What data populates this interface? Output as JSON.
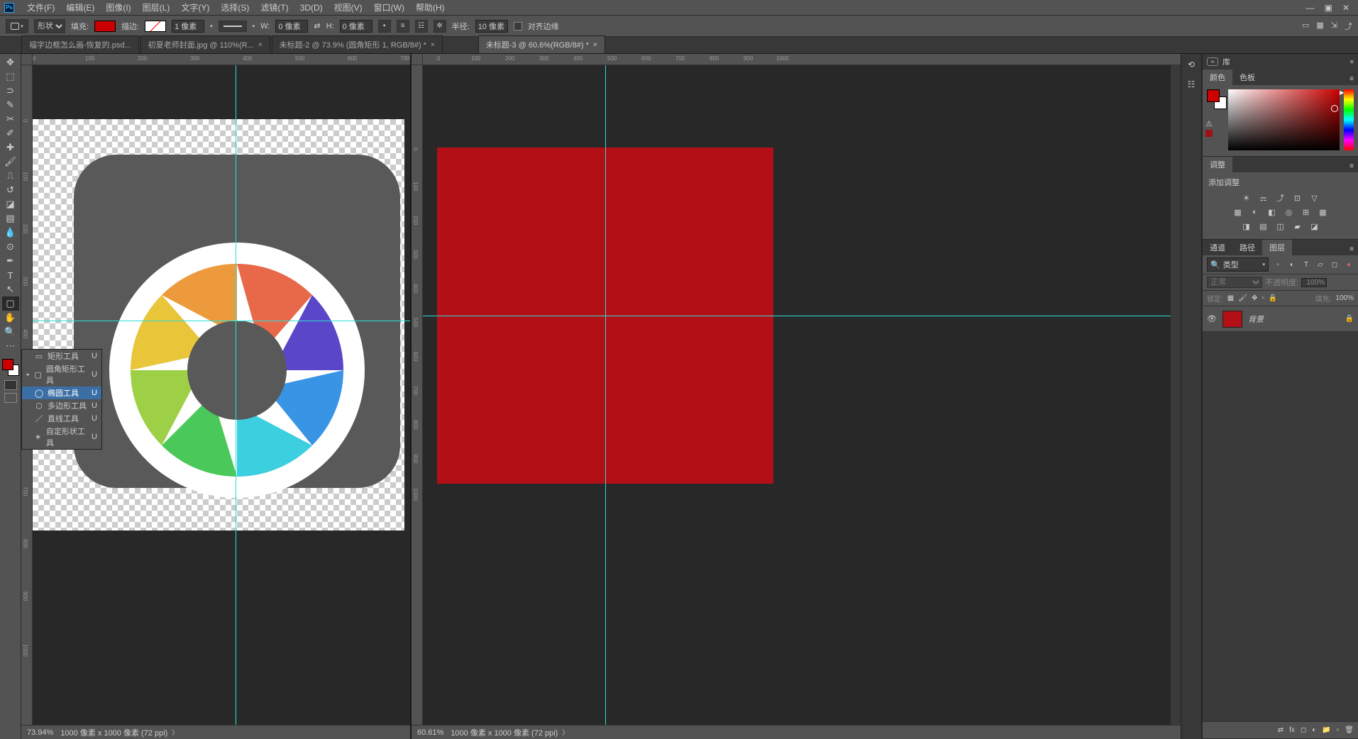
{
  "menubar": {
    "items": [
      "文件(F)",
      "编辑(E)",
      "图像(I)",
      "图层(L)",
      "文字(Y)",
      "选择(S)",
      "滤镜(T)",
      "3D(D)",
      "视图(V)",
      "窗口(W)",
      "帮助(H)"
    ]
  },
  "optionsbar": {
    "shape_mode": "形状",
    "fill_label": "填充:",
    "stroke_label": "描边:",
    "stroke_width": "1 像素",
    "w_label": "W:",
    "w_value": "0 像素",
    "h_label": "H:",
    "h_value": "0 像素",
    "radius_label": "半径:",
    "radius_value": "10 像素",
    "align_edges": "对齐边缘"
  },
  "doc_tabs": [
    {
      "title": "福字边框怎么画-恢复的.psd...",
      "active": false
    },
    {
      "title": "初夏老师封面.jpg @ 110%(R...",
      "active": false
    },
    {
      "title": "未标题-2 @ 73.9% (圆角矩形 1, RGB/8#) *",
      "active": false
    },
    {
      "title": "未标题-3 @ 60.6%(RGB/8#) *",
      "active": true
    }
  ],
  "tool_flyout": {
    "items": [
      {
        "icon": "▭",
        "label": "矩形工具",
        "key": "U",
        "selected": false,
        "current": false
      },
      {
        "icon": "▢",
        "label": "圆角矩形工具",
        "key": "U",
        "selected": false,
        "current": true
      },
      {
        "icon": "◯",
        "label": "椭圆工具",
        "key": "U",
        "selected": true,
        "current": false
      },
      {
        "icon": "⬡",
        "label": "多边形工具",
        "key": "U",
        "selected": false,
        "current": false
      },
      {
        "icon": "／",
        "label": "直线工具",
        "key": "U",
        "selected": false,
        "current": false
      },
      {
        "icon": "✶",
        "label": "自定形状工具",
        "key": "U",
        "selected": false,
        "current": false
      }
    ]
  },
  "ruler_left_h": [
    "0",
    "100",
    "200",
    "300",
    "400",
    "500",
    "600",
    "700"
  ],
  "ruler_left_v": [
    "0",
    "100",
    "200",
    "300",
    "400",
    "500",
    "600",
    "700",
    "800",
    "900",
    "1000"
  ],
  "ruler_right_h": [
    "0",
    "100",
    "200",
    "300",
    "400",
    "500",
    "600",
    "700",
    "800",
    "900",
    "1000"
  ],
  "ruler_right_v": [
    "0",
    "100",
    "200",
    "300",
    "400",
    "500",
    "600",
    "700",
    "800",
    "900",
    "1000"
  ],
  "status_left": {
    "zoom": "73.94%",
    "doc": "1000 像素 x 1000 像素 (72 ppi)"
  },
  "status_right": {
    "zoom": "60.61%",
    "doc": "1000 像素 x 1000 像素 (72 ppi)"
  },
  "panels": {
    "color_tab": "颜色",
    "swatches_tab": "色板",
    "library_tab": "库",
    "adjust_tab": "调整",
    "adjust_label": "添加调整",
    "channels_tab": "通道",
    "paths_tab": "路径",
    "layers_tab": "图层",
    "layer_filter_kind": "类型",
    "blend_mode": "正常",
    "opacity_label": "不透明度:",
    "opacity_value": "100%",
    "lock_label": "锁定:",
    "fill_label": "填充:",
    "fill_value": "100%",
    "bg_layer": "背景"
  }
}
